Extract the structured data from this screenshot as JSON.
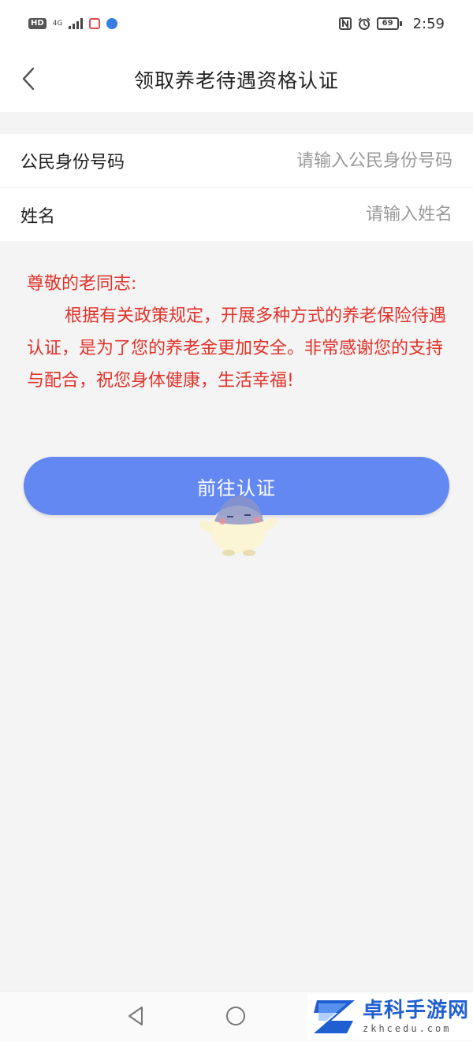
{
  "status_bar": {
    "hd": "HD",
    "network": "4G",
    "battery": "69",
    "time": "2:59",
    "icons": [
      "hd-icon",
      "signal-icon",
      "red-app-icon",
      "blue-app-icon",
      "nfc-icon",
      "alarm-icon",
      "battery-icon"
    ]
  },
  "header": {
    "title": "领取养老待遇资格认证",
    "back_icon": "chevron-left-icon"
  },
  "form": {
    "id_label": "公民身份号码",
    "id_placeholder": "请输入公民身份号码",
    "name_label": "姓名",
    "name_placeholder": "请输入姓名"
  },
  "notice": {
    "greeting": "尊敬的老同志:",
    "body": "根据有关政策规定，开展多种方式的养老保险待遇认证，是为了您的养老金更加安全。非常感谢您的支持与配合，祝您身体健康，生活幸福!",
    "color": "#e0332a"
  },
  "action": {
    "button_label": "前往认证",
    "color": "#6488f2"
  },
  "nav": {
    "icons": [
      "back-triangle-icon",
      "home-circle-icon"
    ]
  },
  "watermark": {
    "title": "卓科手游网",
    "subtitle": "zkhcedu.com"
  }
}
